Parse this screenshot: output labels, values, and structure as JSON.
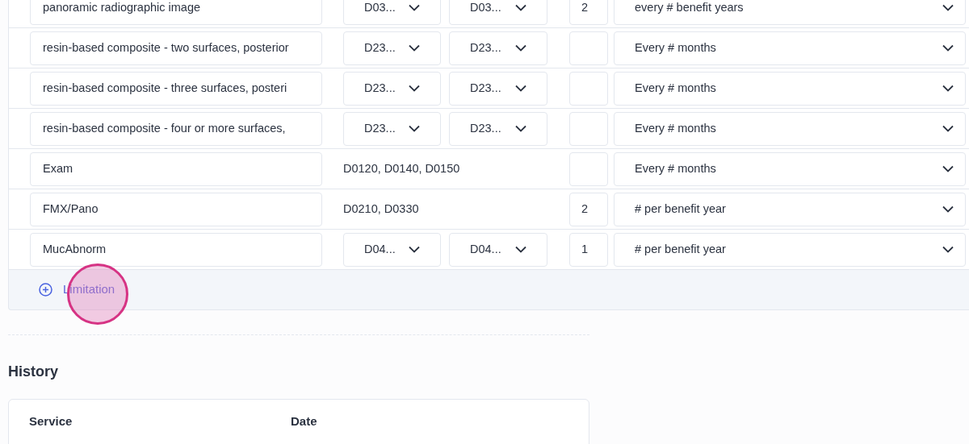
{
  "limitations": [
    {
      "kind": "dropdowns",
      "name": "panoramic radiographic image",
      "code_from": "D03...",
      "code_to": "D03...",
      "count": "2",
      "frequency": "every # benefit years"
    },
    {
      "kind": "dropdowns",
      "name": "resin-based composite - two surfaces, posterior",
      "code_from": "D23...",
      "code_to": "D23...",
      "frequency": "Every # months"
    },
    {
      "kind": "dropdowns",
      "name": "resin-based composite - three surfaces, posteri",
      "code_from": "D23...",
      "code_to": "D23...",
      "frequency": "Every # months"
    },
    {
      "kind": "dropdowns",
      "name": "resin-based composite - four or more surfaces,",
      "code_from": "D23...",
      "code_to": "D23...",
      "frequency": "Every # months"
    },
    {
      "kind": "text",
      "name": "Exam",
      "codes": "D0120, D0140, D0150",
      "frequency": "Every # months"
    },
    {
      "kind": "text",
      "name": "FMX/Pano",
      "codes": "D0210, D0330",
      "count": "2",
      "frequency": "# per benefit year"
    },
    {
      "kind": "dropdowns",
      "name": "MucAbnorm",
      "code_from": "D04...",
      "code_to": "D04...",
      "count": "1",
      "frequency": "# per benefit year"
    }
  ],
  "add_button": {
    "label": "Limitation"
  },
  "history": {
    "title": "History",
    "columns": [
      "Service",
      "Date"
    ]
  }
}
